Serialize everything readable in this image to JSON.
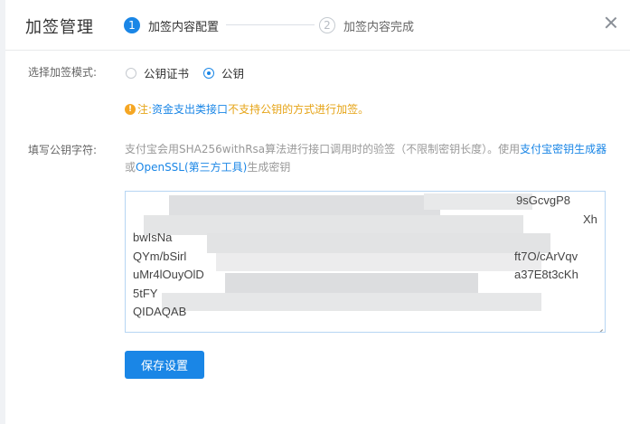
{
  "modal": {
    "title": "加签管理"
  },
  "steps": [
    {
      "num": "1",
      "label": "加签内容配置"
    },
    {
      "num": "2",
      "label": "加签内容完成"
    }
  ],
  "mode": {
    "label": "选择加签模式:",
    "options": [
      {
        "label": "公钥证书",
        "checked": false
      },
      {
        "label": "公钥",
        "checked": true
      }
    ]
  },
  "note": {
    "prefix": "注:",
    "link": "资金支出类接口",
    "suffix": "不支持公钥的方式进行加签。"
  },
  "pubkey": {
    "label": "填写公钥字符:",
    "desc_text": "支付宝会用SHA256withRsa算法进行接口调用时的验签（不限制密钥长度）。使用",
    "desc_link1": "支付宝密钥生成器",
    "desc_or": "或",
    "desc_link2": "OpenSSL(第三方工具)",
    "desc_tail": "生成密钥",
    "visible_fragments": [
      "bwIsNa",
      "QYm/bSirl",
      "uMr4lOuyOlD",
      "5tFY",
      "QIDAQAB",
      "9sGcvgP8",
      "Xh",
      "ft7O/cArVqv",
      "a37E8t3cKh"
    ]
  },
  "save_label": "保存设置",
  "colors": {
    "accent": "#1a86e6",
    "warning": "#f5a623"
  }
}
